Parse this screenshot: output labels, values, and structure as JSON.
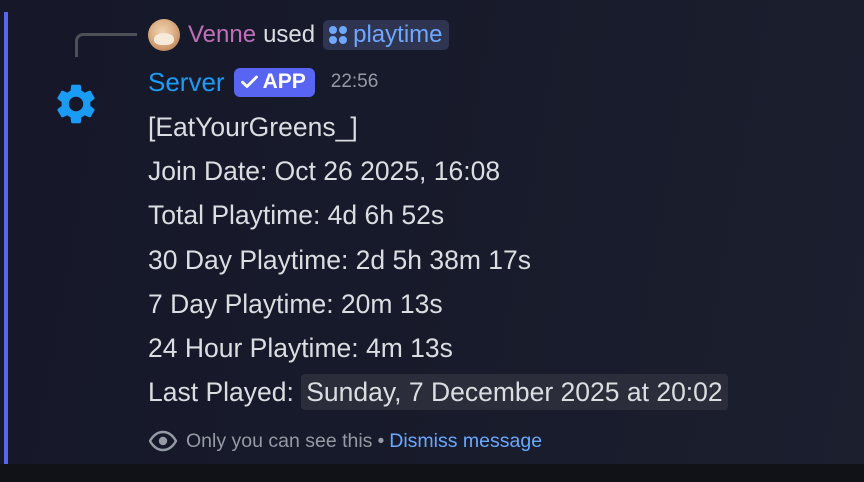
{
  "reply": {
    "user": "Venne",
    "used": "used",
    "command": "playtime"
  },
  "header": {
    "bot_name": "Server",
    "badge": "APP",
    "timestamp": "22:56"
  },
  "content": {
    "lines": [
      "[EatYourGreens_]",
      "Join Date: Oct 26 2025, 16:08",
      "Total Playtime: 4d 6h 52s",
      "30 Day Playtime: 2d 5h 38m 17s",
      "7 Day Playtime: 20m 13s",
      "24 Hour Playtime: 4m 13s"
    ],
    "last_played_label": "Last Played:",
    "last_played_value": "Sunday, 7 December 2025 at 20:02"
  },
  "ephemeral": {
    "notice": "Only you can see this",
    "separator": "•",
    "dismiss": "Dismiss message"
  },
  "icons": {
    "bot_avatar": "gear-icon",
    "command": "command-icon",
    "verified": "checkmark-icon",
    "visibility": "eye-icon"
  },
  "colors": {
    "accent": "#5865f2",
    "bot_name": "#1a9bf5",
    "link": "#6aa8ff",
    "reply_user": "#c070b8"
  }
}
